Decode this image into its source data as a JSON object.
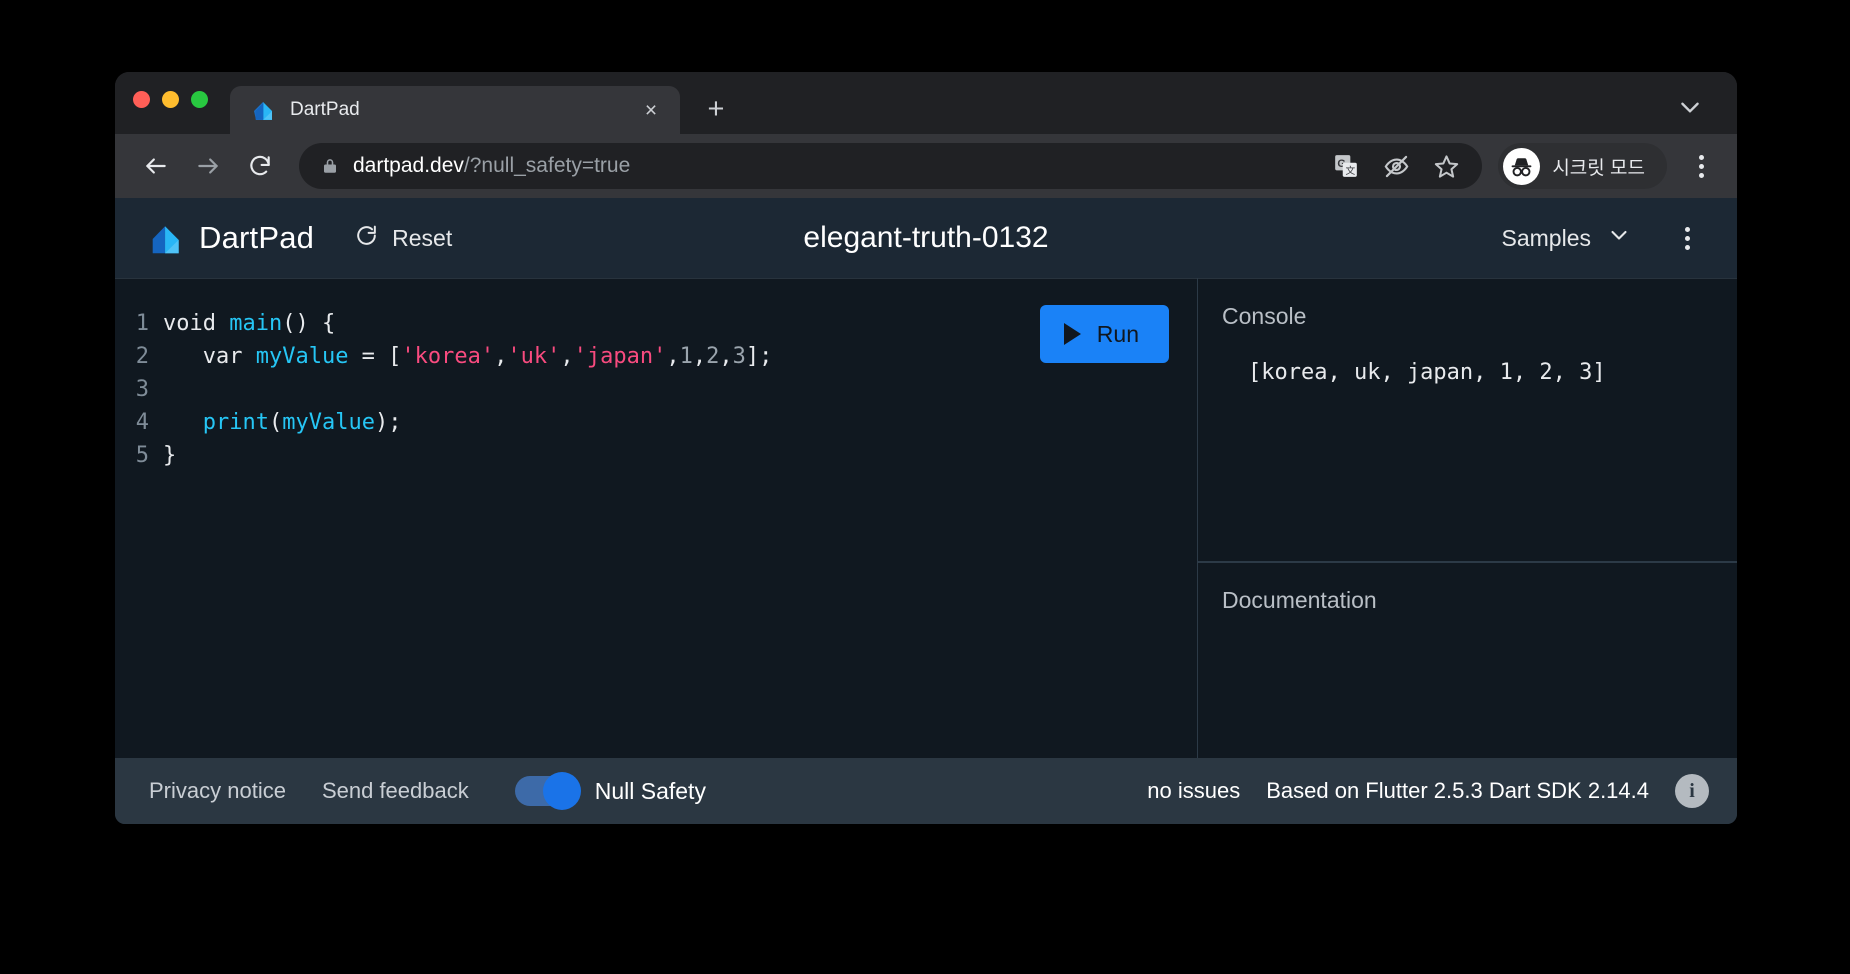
{
  "window": {
    "traffic_lights": [
      "close",
      "minimize",
      "maximize"
    ]
  },
  "tabstrip": {
    "tab": {
      "title": "DartPad",
      "favicon": "dart-logo-icon",
      "close": "×"
    },
    "new_tab_label": "+",
    "chevron": "chevron-down-icon"
  },
  "omnibox": {
    "back": "arrow-left-icon",
    "forward": "arrow-right-icon",
    "reload": "reload-icon",
    "lock": "lock-icon",
    "url_domain": "dartpad.dev",
    "url_path": "/?null_safety=true",
    "url_full": "dartpad.dev/?null_safety=true",
    "icons": [
      "translate-icon",
      "eye-off-icon",
      "star-icon"
    ],
    "incognito_label": "시크릿 모드",
    "menu": "kebab-menu-icon"
  },
  "dartpad": {
    "brand": "DartPad",
    "reset_label": "Reset",
    "reset_icon": "refresh-icon",
    "title": "elegant-truth-0132",
    "samples_label": "Samples",
    "samples_chevron": "chevron-down-icon",
    "overflow_menu": "kebab-menu-icon",
    "run_label": "Run",
    "run_icon": "play-icon",
    "accent_blue": "#1a82f7"
  },
  "editor": {
    "lines": [
      {
        "number": "1",
        "tokens": [
          {
            "t": "void ",
            "c": "kw"
          },
          {
            "t": "main",
            "c": "fn"
          },
          {
            "t": "() {",
            "c": "punct"
          }
        ]
      },
      {
        "number": "2",
        "tokens": [
          {
            "t": "   var ",
            "c": "kw"
          },
          {
            "t": "myValue",
            "c": "id"
          },
          {
            "t": " = [",
            "c": "punct"
          },
          {
            "t": "'korea'",
            "c": "str"
          },
          {
            "t": ",",
            "c": "punct"
          },
          {
            "t": "'uk'",
            "c": "str"
          },
          {
            "t": ",",
            "c": "punct"
          },
          {
            "t": "'japan'",
            "c": "str"
          },
          {
            "t": ",",
            "c": "punct"
          },
          {
            "t": "1",
            "c": "num"
          },
          {
            "t": ",",
            "c": "punct"
          },
          {
            "t": "2",
            "c": "num"
          },
          {
            "t": ",",
            "c": "punct"
          },
          {
            "t": "3",
            "c": "num"
          },
          {
            "t": "];",
            "c": "punct"
          }
        ]
      },
      {
        "number": "3",
        "tokens": []
      },
      {
        "number": "4",
        "tokens": [
          {
            "t": "   ",
            "c": "punct"
          },
          {
            "t": "print",
            "c": "fn"
          },
          {
            "t": "(",
            "c": "punct"
          },
          {
            "t": "myValue",
            "c": "id"
          },
          {
            "t": ");",
            "c": "punct"
          }
        ]
      },
      {
        "number": "5",
        "tokens": [
          {
            "t": "}",
            "c": "punct"
          }
        ]
      }
    ]
  },
  "console": {
    "title": "Console",
    "output": "[korea, uk, japan, 1, 2, 3]"
  },
  "documentation": {
    "title": "Documentation",
    "content": ""
  },
  "footer": {
    "privacy_notice": "Privacy notice",
    "send_feedback": "Send feedback",
    "null_safety_label": "Null Safety",
    "null_safety_on": true,
    "issues": "no issues",
    "version": "Based on Flutter 2.5.3 Dart SDK 2.14.4",
    "info_icon": "info-icon",
    "info_glyph": "i"
  }
}
